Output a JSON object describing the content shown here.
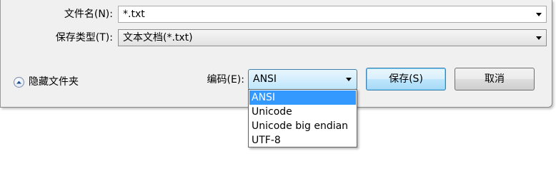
{
  "dialog": {
    "filename": {
      "label": "文件名(N):",
      "value": "*.txt"
    },
    "save_type": {
      "label": "保存类型(T):",
      "value": "文本文档(*.txt)"
    },
    "hide_folders": {
      "label": "隐藏文件夹",
      "icon": "chevron-up-icon"
    },
    "encoding": {
      "label": "编码(E):",
      "value": "ANSI",
      "options": [
        "ANSI",
        "Unicode",
        "Unicode big endian",
        "UTF-8"
      ],
      "highlighted_option": "ANSI"
    },
    "buttons": {
      "save": "保存(S)",
      "cancel": "取消"
    }
  },
  "colors": {
    "dialog_bg": "#f0f0f0",
    "selection_bg": "#3399ff",
    "focus_border": "#3c7fb1"
  }
}
